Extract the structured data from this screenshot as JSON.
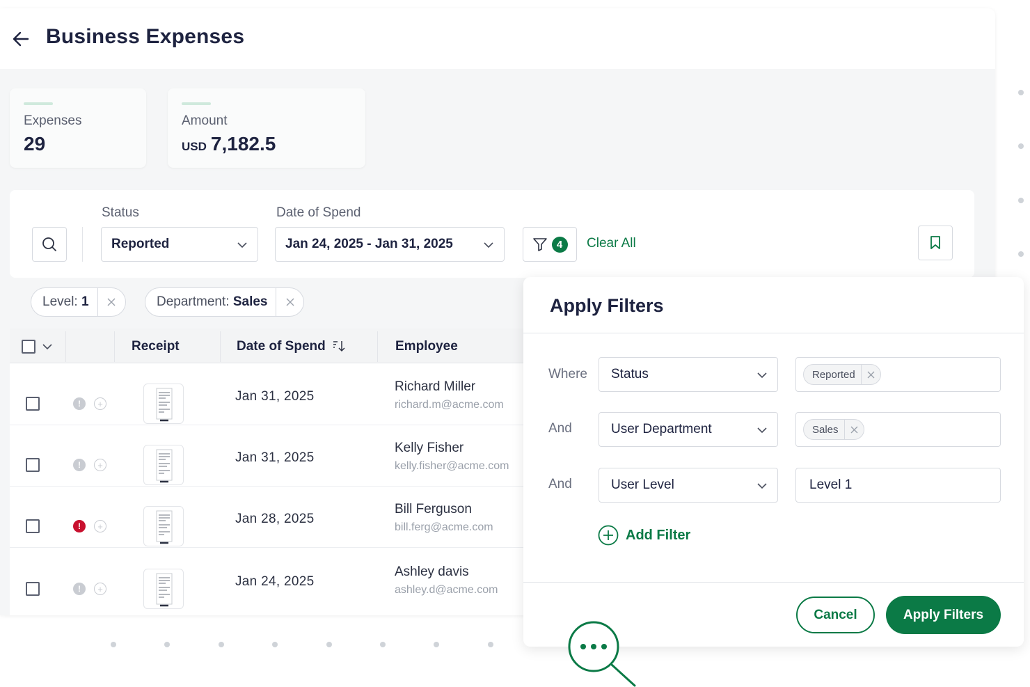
{
  "header": {
    "title": "Business Expenses"
  },
  "stats": [
    {
      "label": "Expenses",
      "value": "29",
      "unit": ""
    },
    {
      "label": "Amount",
      "value": "7,182.5",
      "unit": "USD"
    }
  ],
  "filters": {
    "status_label": "Status",
    "status_value": "Reported",
    "date_label": "Date of Spend",
    "date_value": "Jan 24, 2025 - Jan 31, 2025",
    "active_count": "4",
    "clear_all": "Clear All"
  },
  "chips": [
    {
      "key": "Level:",
      "value": "1"
    },
    {
      "key": "Department:",
      "value": "Sales"
    }
  ],
  "table": {
    "columns": [
      "Receipt",
      "Date of Spend",
      "Employee"
    ],
    "rows": [
      {
        "date": "Jan 31, 2025",
        "name": "Richard Miller",
        "email": "richard.m@acme.com",
        "alert": "normal"
      },
      {
        "date": "Jan 31, 2025",
        "name": "Kelly Fisher",
        "email": "kelly.fisher@acme.com",
        "alert": "normal"
      },
      {
        "date": "Jan 28, 2025",
        "name": "Bill Ferguson",
        "email": "bill.ferg@acme.com",
        "alert": "error"
      },
      {
        "date": "Jan 24, 2025",
        "name": "Ashley davis",
        "email": "ashley.d@acme.com",
        "alert": "normal"
      }
    ]
  },
  "modal": {
    "title": "Apply Filters",
    "conditions": [
      {
        "connector": "Where",
        "field": "Status",
        "value": "Reported",
        "value_type": "tag"
      },
      {
        "connector": "And",
        "field": "User Department",
        "value": "Sales",
        "value_type": "tag"
      },
      {
        "connector": "And",
        "field": "User Level",
        "value": "Level 1",
        "value_type": "text"
      }
    ],
    "add_filter": "Add Filter",
    "cancel": "Cancel",
    "apply": "Apply Filters"
  },
  "colors": {
    "accent": "#0b7a46",
    "title": "#1e2340",
    "error": "#c8102e"
  },
  "icons": [
    "back-arrow-icon",
    "search-icon",
    "chevron-down-icon",
    "filter-icon",
    "bookmark-icon",
    "close-icon",
    "sort-icon",
    "warning-icon",
    "add-circle-icon",
    "receipt-icon",
    "magnifier-chat-icon"
  ]
}
